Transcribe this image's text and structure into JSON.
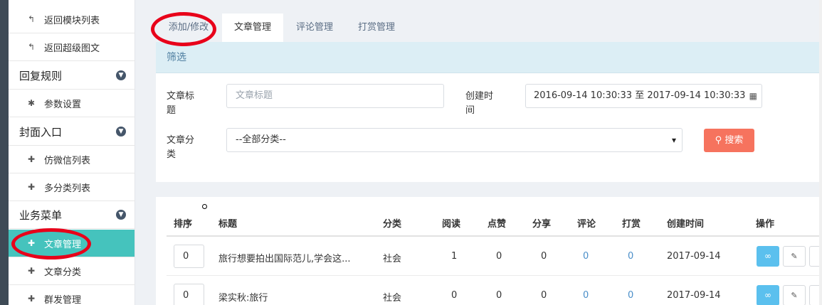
{
  "sidebar": {
    "items": [
      {
        "label": "返回模块列表",
        "icon": "back-arrow-icon",
        "type": "item"
      },
      {
        "label": "返回超级图文",
        "icon": "back-arrow-icon",
        "type": "item"
      },
      {
        "label": "回复规则",
        "icon": "chevron-down-icon",
        "type": "header"
      },
      {
        "label": "参数设置",
        "icon": "gear-icon",
        "type": "item"
      },
      {
        "label": "封面入口",
        "icon": "chevron-down-icon",
        "type": "header"
      },
      {
        "label": "仿微信列表",
        "icon": "puzzle-icon",
        "type": "item"
      },
      {
        "label": "多分类列表",
        "icon": "puzzle-icon",
        "type": "item"
      },
      {
        "label": "业务菜单",
        "icon": "chevron-down-icon",
        "type": "header"
      },
      {
        "label": "文章管理",
        "icon": "puzzle-icon",
        "type": "item",
        "active": true
      },
      {
        "label": "文章分类",
        "icon": "puzzle-icon",
        "type": "item"
      },
      {
        "label": "群发管理",
        "icon": "puzzle-icon",
        "type": "item"
      }
    ]
  },
  "tabs": [
    {
      "label": "添加/修改"
    },
    {
      "label": "文章管理",
      "active": true
    },
    {
      "label": "评论管理"
    },
    {
      "label": "打赏管理"
    }
  ],
  "filter": {
    "title": "筛选",
    "title_label": "文章标题",
    "title_placeholder": "文章标题",
    "time_label": "创建时间",
    "time_value": "2016-09-14 10:30:33 至 2017-09-14 10:30:33",
    "category_label": "文章分类",
    "category_value": "--全部分类--",
    "search_button": "搜索"
  },
  "table": {
    "headers": [
      "排序",
      "标题",
      "分类",
      "阅读",
      "点赞",
      "分享",
      "评论",
      "打赏",
      "创建时间",
      "操作"
    ],
    "rows": [
      {
        "order": "0",
        "title": "旅行想要拍出国际范儿,学会这...",
        "category": "社会",
        "reads": "1",
        "likes": "0",
        "shares": "0",
        "comments": "0",
        "rewards": "0",
        "created": "2017-09-14"
      },
      {
        "order": "0",
        "title": "梁实秋:旅行",
        "category": "社会",
        "reads": "0",
        "likes": "0",
        "shares": "0",
        "comments": "0",
        "rewards": "0",
        "created": "2017-09-14"
      }
    ]
  },
  "colors": {
    "active_menu": "#45c3bd",
    "search_button": "#f6735e",
    "filter_header": "#dceef5",
    "link_button": "#5bc0ee",
    "annotation": "#e8001a"
  }
}
